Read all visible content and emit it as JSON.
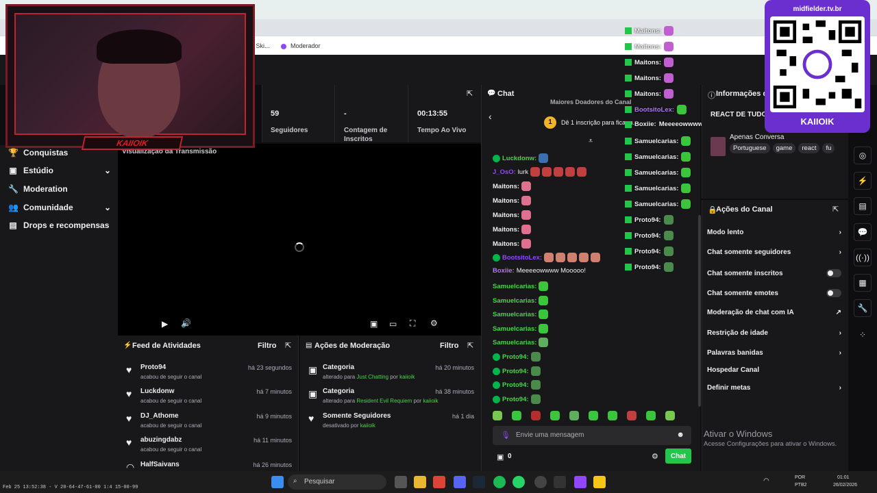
{
  "browser": {
    "bookmark_1": "2 Ski...",
    "bookmark_2": "Moderador"
  },
  "webcam": {
    "plate": "KAIIOIK"
  },
  "sidebar": {
    "items": [
      {
        "icon": "trophy-icon",
        "label": "Conquistas"
      },
      {
        "icon": "studio-icon",
        "label": "Estúdio"
      },
      {
        "icon": "wrench-icon",
        "label": "Moderation"
      },
      {
        "icon": "community-icon",
        "label": "Comunidade"
      },
      {
        "icon": "drops-icon",
        "label": "Drops e recompensas"
      }
    ]
  },
  "stats": [
    {
      "value": "59",
      "label": "Seguidores"
    },
    {
      "value": "-",
      "label": "Contagem de Inscritos"
    },
    {
      "value": "00:13:55",
      "label": "Tempo Ao Vivo"
    }
  ],
  "video": {
    "title": "Visualização da Transmissão"
  },
  "feed": {
    "title": "Feed de Atividades",
    "filter": "Filtro",
    "rows": [
      {
        "name": "Proto94",
        "sub": "acabou de seguir o canal",
        "time": "há 23 segundos"
      },
      {
        "name": "Luckdonw",
        "sub": "acabou de seguir o canal",
        "time": "há 7 minutos"
      },
      {
        "name": "DJ_Athome",
        "sub": "acabou de seguir o canal",
        "time": "há 9 minutos"
      },
      {
        "name": "abuzingdabz",
        "sub": "acabou de seguir o canal",
        "time": "há 11 minutos"
      },
      {
        "name": "HalfSaivans",
        "sub": "",
        "time": "há 26 minutos"
      }
    ]
  },
  "moderation": {
    "title": "Ações de Moderação",
    "filter": "Filtro",
    "rows": [
      {
        "name": "Categoria",
        "sub_pre": "alterado para ",
        "sub_link": "Just Chatting",
        "sub_mid": " por ",
        "sub_user": "kaiioik",
        "time": "há 20 minutos"
      },
      {
        "name": "Categoria",
        "sub_pre": "alterado para ",
        "sub_link": "Resident Evil Requiem",
        "sub_mid": " por ",
        "sub_user": "kaiioik",
        "time": "há 38 minutos"
      },
      {
        "name": "Somente Seguidores",
        "sub_pre": "desativado por ",
        "sub_link": "",
        "sub_mid": "",
        "sub_user": "kaiioik",
        "time": "há 1 dia"
      }
    ]
  },
  "chat": {
    "title": "Chat",
    "top_donors": "Maiores Doadores do Canal",
    "gift_rank": "1",
    "gift_prompt": "Dê 1 inscrição para ficar n...",
    "messages": [
      {
        "user": "Luckdonw:",
        "text": "",
        "color": "#45d545",
        "badge": true
      },
      {
        "user": "J_OsO:",
        "text": "lurk",
        "color": "#9147ff",
        "badge": false
      },
      {
        "user": "Maitons:",
        "text": "",
        "color": "#efeff1",
        "badge": false
      },
      {
        "user": "Maitons:",
        "text": "",
        "color": "#efeff1",
        "badge": false
      },
      {
        "user": "Maitons:",
        "text": "",
        "color": "#efeff1",
        "badge": false
      },
      {
        "user": "Maitons:",
        "text": "",
        "color": "#efeff1",
        "badge": false
      },
      {
        "user": "Maitons:",
        "text": "",
        "color": "#efeff1",
        "badge": false
      },
      {
        "user": "BootsitoLex:",
        "text": "",
        "color": "#9147ff",
        "badge": true
      },
      {
        "user": "Boxiie:",
        "text": "Meeeeowwww Mooooo!",
        "color": "#b07ce8",
        "badge": false
      },
      {
        "user": "Samuelcarias:",
        "text": "",
        "color": "#45d545",
        "badge": false
      },
      {
        "user": "Samuelcarias:",
        "text": "",
        "color": "#45d545",
        "badge": false
      },
      {
        "user": "Samuelcarias:",
        "text": "",
        "color": "#45d545",
        "badge": false
      },
      {
        "user": "Samuelcarias:",
        "text": "",
        "color": "#45d545",
        "badge": false
      },
      {
        "user": "Samuelcarias:",
        "text": "",
        "color": "#45d545",
        "badge": false
      },
      {
        "user": "Proto94:",
        "text": "",
        "color": "#45d545",
        "badge": true
      },
      {
        "user": "Proto94:",
        "text": "",
        "color": "#45d545",
        "badge": true
      },
      {
        "user": "Proto94:",
        "text": "",
        "color": "#45d545",
        "badge": true
      },
      {
        "user": "Proto94:",
        "text": "",
        "color": "#45d545",
        "badge": true
      }
    ],
    "input_placeholder": "Envie uma mensagem",
    "points": "0",
    "send_label": "Chat"
  },
  "overlay_chat": [
    {
      "user": "Maitons:",
      "text": ""
    },
    {
      "user": "Maitons:",
      "text": ""
    },
    {
      "user": "Maitons:",
      "text": ""
    },
    {
      "user": "Maitons:",
      "text": ""
    },
    {
      "user": "Maitons:",
      "text": ""
    },
    {
      "user": "BootsitoLex:",
      "text": ""
    },
    {
      "user": "Boxiie:",
      "text": "Meeeeowwww Mooooo!"
    },
    {
      "user": "Samuelcarias:",
      "text": ""
    },
    {
      "user": "Samuelcarias:",
      "text": ""
    },
    {
      "user": "Samuelcarias:",
      "text": ""
    },
    {
      "user": "Samuelcarias:",
      "text": ""
    },
    {
      "user": "Samuelcarias:",
      "text": ""
    },
    {
      "user": "Proto94:",
      "text": ""
    },
    {
      "user": "Proto94:",
      "text": ""
    },
    {
      "user": "Proto94:",
      "text": ""
    },
    {
      "user": "Proto94:",
      "text": ""
    }
  ],
  "info": {
    "title": "Informações da",
    "stream_title": "REACT DE TUDO SUGESTÃO!",
    "category": "Apenas Conversa",
    "tags": [
      "Portuguese",
      "game",
      "react",
      "fu"
    ]
  },
  "actions": {
    "title": "Ações do Canal",
    "items": [
      {
        "label": "Modo lento",
        "control": "chevron"
      },
      {
        "label": "Chat somente seguidores",
        "control": "chevron"
      },
      {
        "label": "Chat somente inscritos",
        "control": "toggle"
      },
      {
        "label": "Chat somente emotes",
        "control": "toggle"
      },
      {
        "label": "Moderação de chat com IA",
        "control": "link"
      },
      {
        "label": "Restrição de idade",
        "control": "chevron"
      },
      {
        "label": "Palavras banidas",
        "control": "chevron"
      },
      {
        "label": "Hospedar Canal",
        "control": "none"
      },
      {
        "label": "Definir metas",
        "control": "chevron"
      }
    ]
  },
  "qr": {
    "url": "midfielder.tv.br",
    "name": "KAIIOIK"
  },
  "windows": {
    "activate_title": "Ativar o Windows",
    "activate_sub": "Acesse Configurações para ativar o Windows."
  },
  "taskbar": {
    "search_placeholder": "Pesquisar",
    "lang": "POR",
    "lang2": "PTB2",
    "time": "01:01",
    "date": "26/02/2026",
    "overlay_text": "Feb 25 13:52:38 - V 20-64-47-61-00 1:4 15-00-99"
  }
}
